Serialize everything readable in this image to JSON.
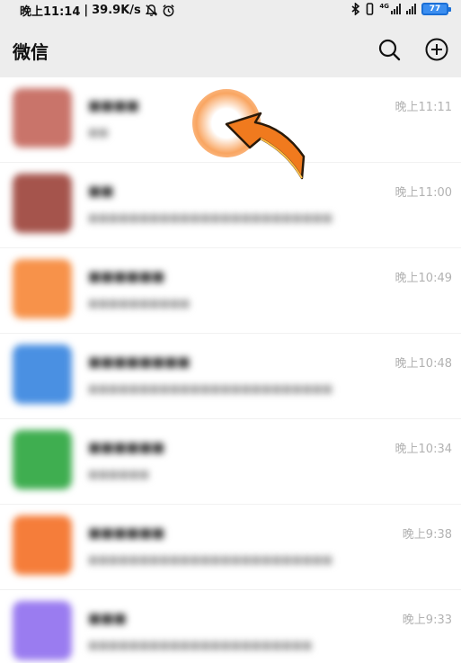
{
  "status_bar": {
    "time": "晚上11:14",
    "speed": "39.9K/s",
    "network_label": "4G",
    "battery_level": "77"
  },
  "header": {
    "title": "微信"
  },
  "chats": [
    {
      "name": "■■■■",
      "preview": "■■",
      "time": "晚上11:11",
      "avatar_color": "#c9746a"
    },
    {
      "name": "■■",
      "preview": "■■■■■■■■■■■■■■■■■■■■■■■■",
      "time": "晚上11:00",
      "avatar_color": "#a5544c"
    },
    {
      "name": "■■■■■■",
      "preview": "■■■■■■■■■■",
      "time": "晚上10:49",
      "avatar_color": "#f7924a"
    },
    {
      "name": "■■■■■■■■",
      "preview": "■■■■■■■■■■■■■■■■■■■■■■■■",
      "time": "晚上10:48",
      "avatar_color": "#4a90e2"
    },
    {
      "name": "■■■■■■",
      "preview": "■■■■■■",
      "time": "晚上10:34",
      "avatar_color": "#3fae50"
    },
    {
      "name": "■■■■■■",
      "preview": "■■■■■■■■■■■■■■■■■■■■■■■■",
      "time": "晚上9:38",
      "avatar_color": "#f57d3a"
    },
    {
      "name": "■■■",
      "preview": "■■■■■■■■■■■■■■■■■■■■■■",
      "time": "晚上9:33",
      "avatar_color": "#9a7cf0"
    }
  ]
}
